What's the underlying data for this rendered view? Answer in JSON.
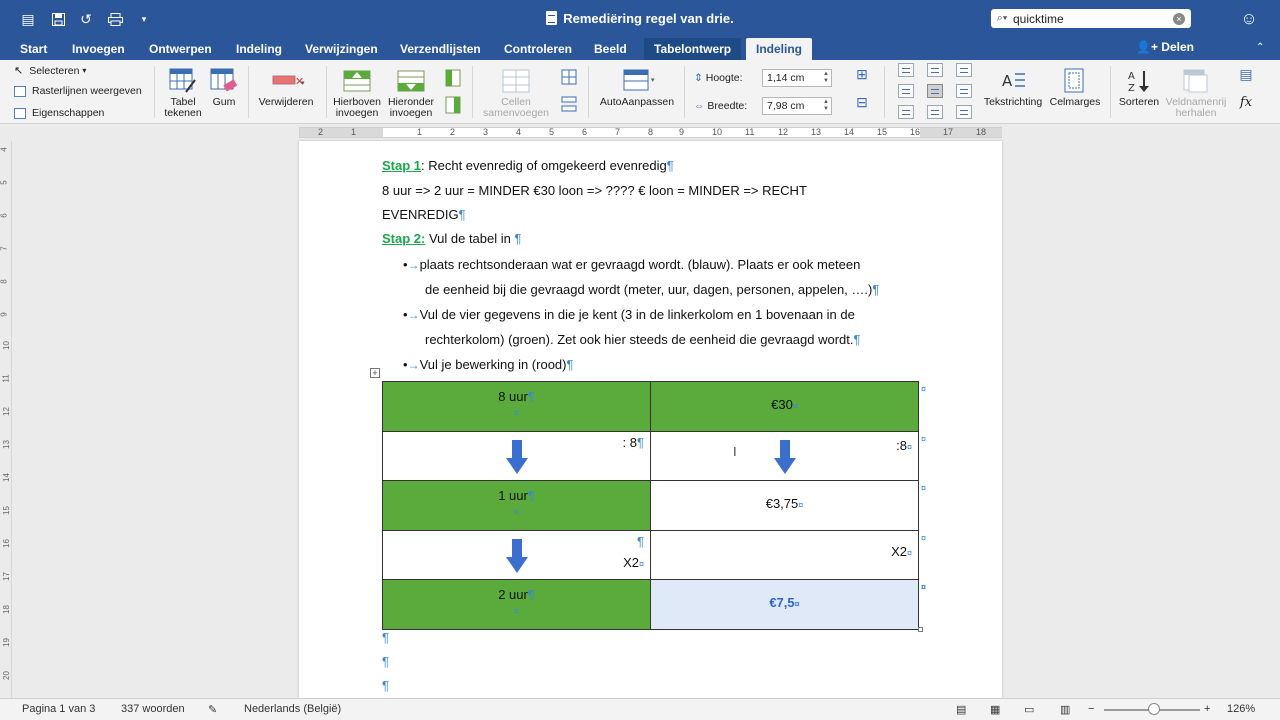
{
  "titlebar": {
    "doc_title": "Remediëring regel van drie.",
    "search_value": "quicktime"
  },
  "tabs": [
    {
      "label": "Start"
    },
    {
      "label": "Invoegen"
    },
    {
      "label": "Ontwerpen"
    },
    {
      "label": "Indeling"
    },
    {
      "label": "Verwijzingen"
    },
    {
      "label": "Verzendlijsten"
    },
    {
      "label": "Controleren"
    },
    {
      "label": "Beeld"
    },
    {
      "label": "Tabelontwerp"
    },
    {
      "label": "Indeling"
    }
  ],
  "share_label": "Delen",
  "ribbon": {
    "select_label": "Selecteren",
    "gridlines_label": "Rasterlijnen weergeven",
    "properties_label": "Eigenschappen",
    "draw_table_label": "Tabel tekenen",
    "eraser_label": "Gum",
    "delete_label": "Verwijderen",
    "insert_above_label": "Hierboven invoegen",
    "insert_below_label": "Hieronder invoegen",
    "merge_cells_label": "Cellen samenvoegen",
    "autofit_label": "AutoAanpassen",
    "height_label": "Hoogte:",
    "height_value": "1,14 cm",
    "width_label": "Breedte:",
    "width_value": "7,98 cm",
    "text_direction_label": "Tekstrichting",
    "cell_margins_label": "Celmarges",
    "sort_label": "Sorteren",
    "repeat_header_label": "Veldnamenrij herhalen"
  },
  "ruler_numbers": [
    "2",
    "1",
    "1",
    "2",
    "3",
    "4",
    "5",
    "6",
    "7",
    "8",
    "9",
    "10",
    "11",
    "12",
    "13",
    "14",
    "15",
    "16",
    "17",
    "18"
  ],
  "vruler_numbers": [
    "4",
    "5",
    "6",
    "7",
    "8",
    "9",
    "10",
    "11",
    "12",
    "13",
    "14",
    "15",
    "16",
    "17",
    "18",
    "19",
    "20"
  ],
  "document": {
    "step1_label": "Stap 1",
    "step1_text": ": Recht evenredig of omgekeerd evenredig",
    "line2": "8 uur => 2 uur = MINDER   €30 loon => ???? € loon = MINDER => RECHT",
    "line3": "EVENREDIG",
    "step2_label": "Stap 2:",
    "step2_text": " Vul de tabel in ",
    "bullet1_a": "plaats rechtsonderaan wat er gevraagd wordt. (blauw). Plaats er ook meteen",
    "bullet1_b": "de eenheid bij die gevraagd wordt (meter, uur, dagen, personen, appelen, ….)",
    "bullet2_a": "Vul de vier gegevens in die je kent (3 in de linkerkolom en 1 bovenaan in de",
    "bullet2_b": "rechterkolom) (groen). Zet ook hier steeds de eenheid die gevraagd wordt.",
    "bullet3": "Vul je bewerking in (rood)"
  },
  "table": {
    "r1_left": "8 uur",
    "r1_right": "€30",
    "r2_left_op": ": 8",
    "r2_right_op": ":8",
    "r3_left": "1 uur",
    "r3_right": "€3,75",
    "r4_left_op": "X2",
    "r4_right_op": "X2",
    "r5_left": "2 uur",
    "r5_right": "€7,5"
  },
  "statusbar": {
    "page": "Pagina 1 van 3",
    "words": "337 woorden",
    "language": "Nederlands (België)",
    "zoom": "126%"
  },
  "colors": {
    "brand": "#2b579a",
    "green_cell": "#5aab3c",
    "answer_cell": "#dfe9f7",
    "step_green": "#1aa64a",
    "arrow_blue": "#3a6fd0"
  }
}
